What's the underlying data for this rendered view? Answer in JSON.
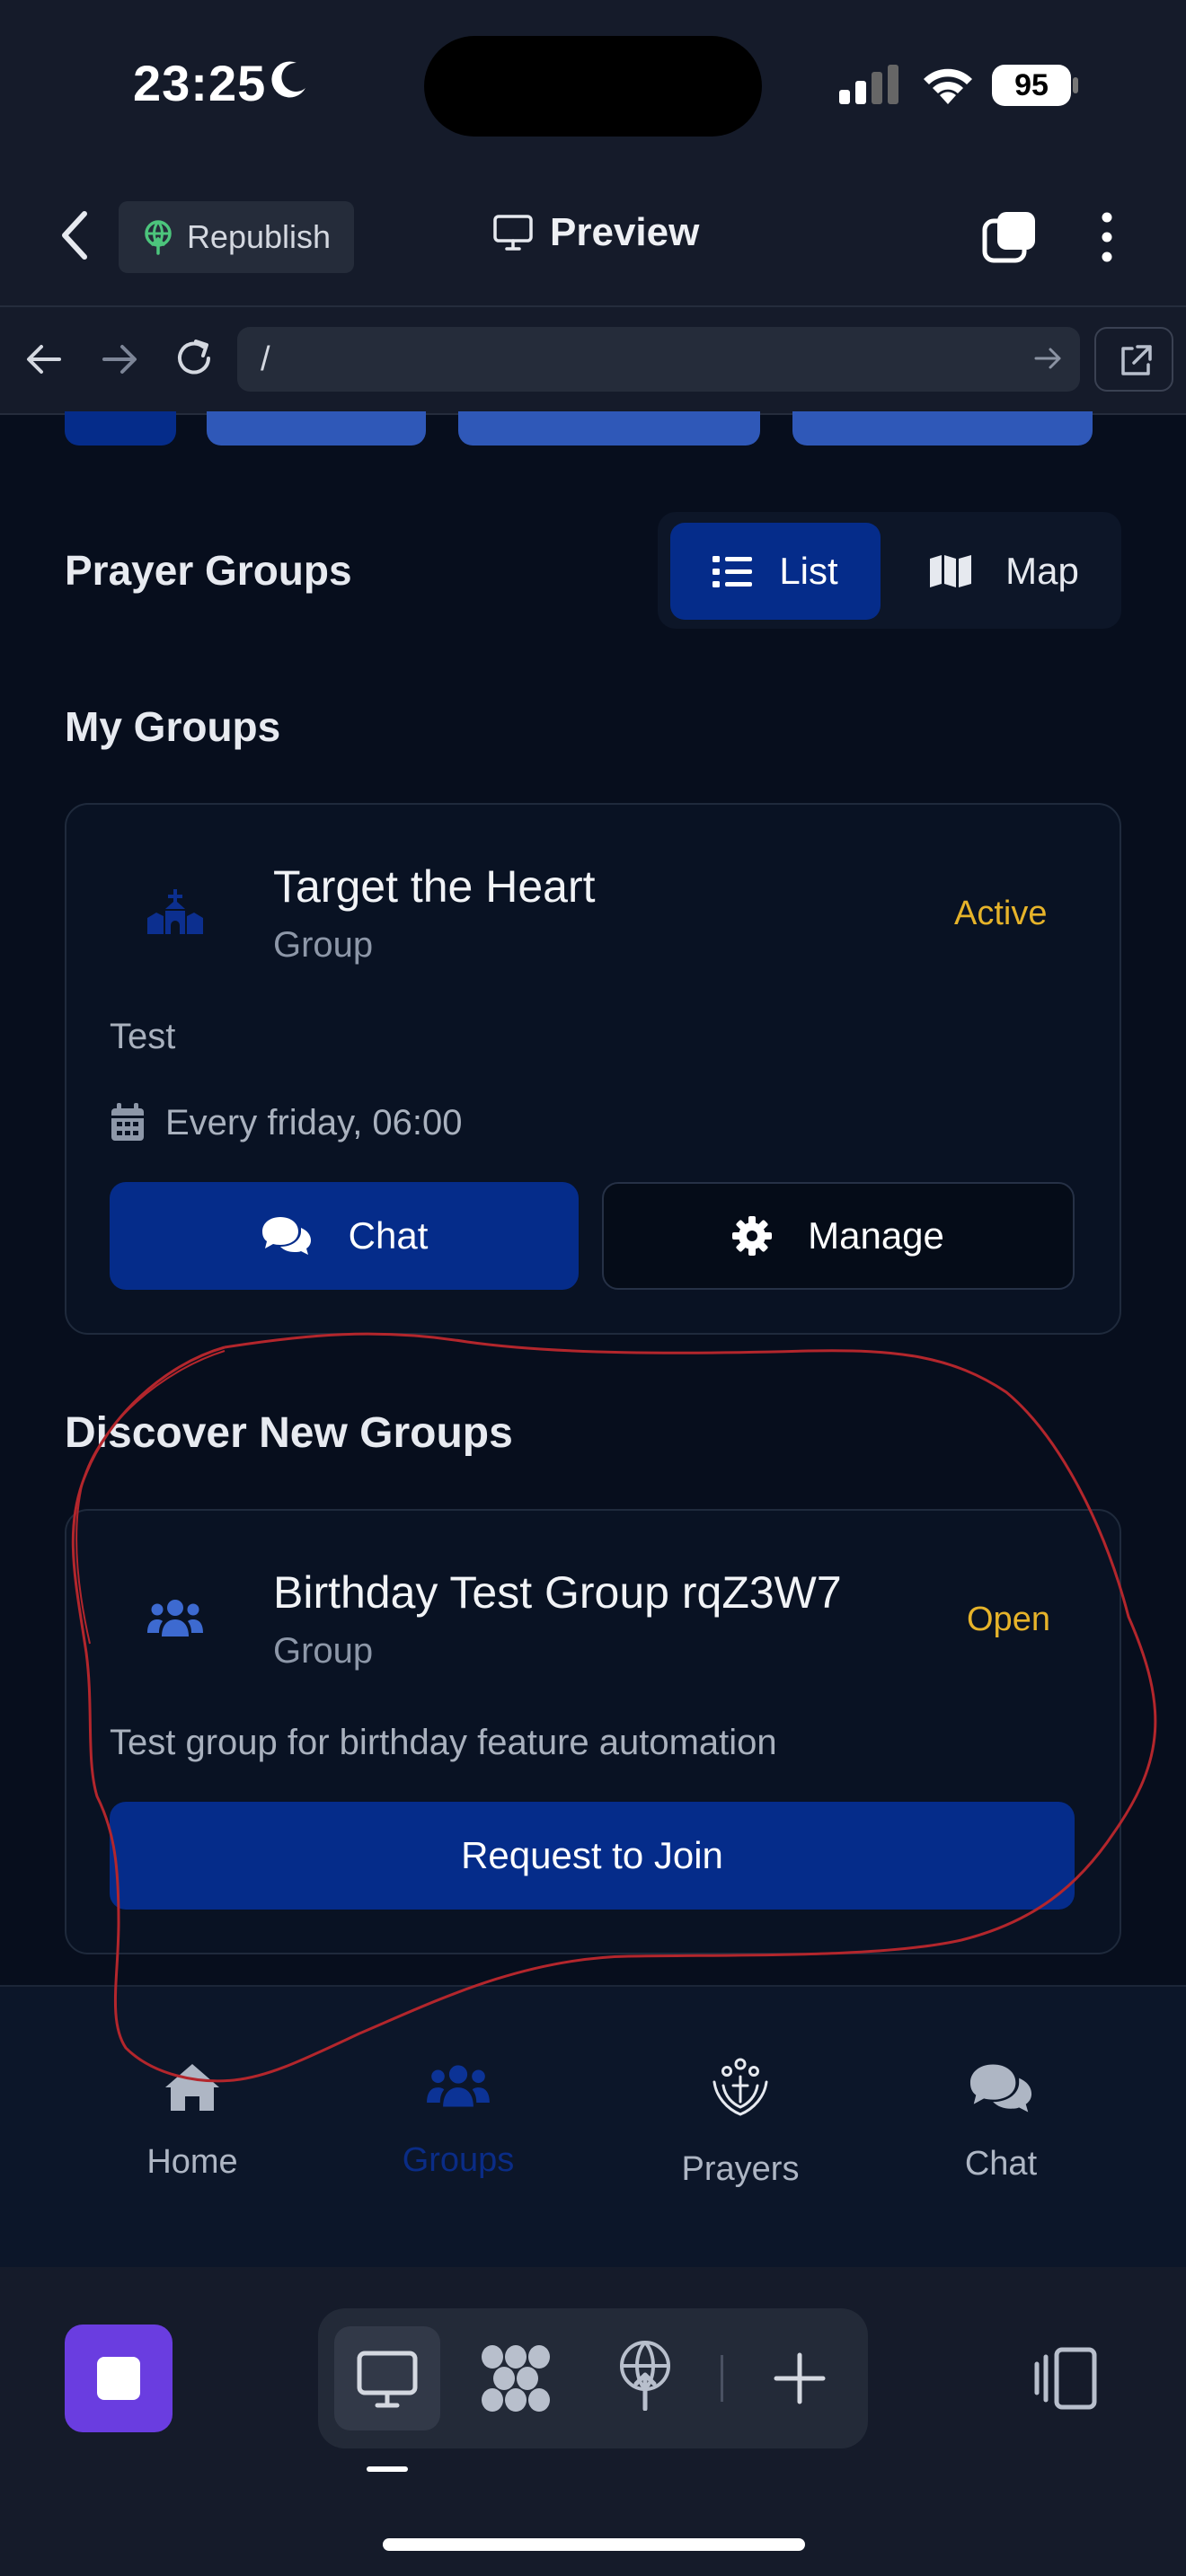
{
  "status_bar": {
    "time": "23:25",
    "battery": "95"
  },
  "header": {
    "republish_label": "Republish",
    "preview_label": "Preview"
  },
  "browser": {
    "url": "/"
  },
  "page": {
    "section_title": "Prayer Groups",
    "view_toggle": {
      "list_label": "List",
      "map_label": "Map",
      "selected": "List"
    },
    "my_groups": {
      "title": "My Groups",
      "items": [
        {
          "name": "Target the Heart",
          "type": "Group",
          "status": "Active",
          "description": "Test",
          "schedule": "Every friday, 06:00",
          "chat_label": "Chat",
          "manage_label": "Manage",
          "icon": "church-icon"
        }
      ]
    },
    "discover": {
      "title": "Discover New Groups",
      "items": [
        {
          "name": "Birthday Test Group rqZ3W7",
          "type": "Group",
          "status": "Open",
          "description": "Test group for birthday feature automation",
          "join_label": "Request to Join",
          "icon": "users-icon"
        }
      ]
    }
  },
  "bottom_nav": {
    "items": [
      {
        "label": "Home",
        "icon": "home-icon"
      },
      {
        "label": "Groups",
        "icon": "users-icon",
        "active": true
      },
      {
        "label": "Prayers",
        "icon": "praying-hands-icon"
      },
      {
        "label": "Chat",
        "icon": "comments-icon"
      }
    ]
  },
  "colors": {
    "accent": "#052c8a",
    "status_active": "#e6b32a",
    "annotation": "#b3262c",
    "stop_button": "#6a3de0"
  }
}
